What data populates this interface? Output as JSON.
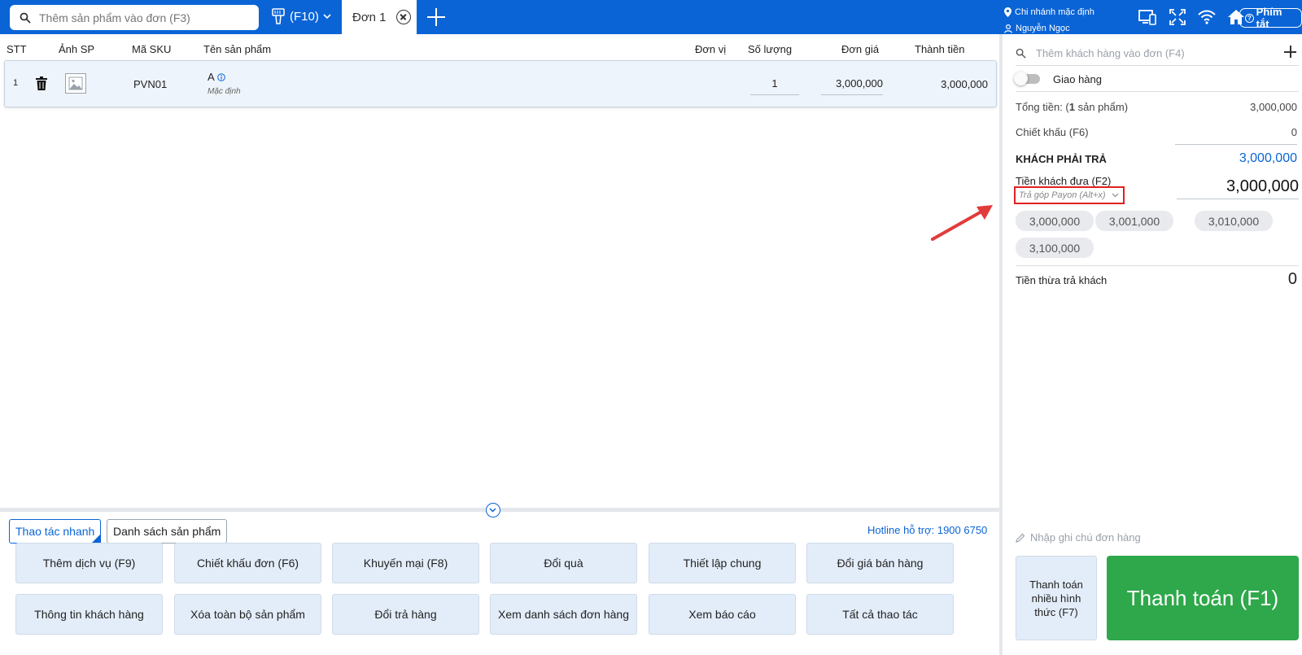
{
  "topbar": {
    "search_placeholder": "Thêm sản phẩm vào đơn (F3)",
    "scan_label": "(F10)",
    "tab_label": "Đơn 1",
    "branch": "Chi nhánh mặc định",
    "user": "Nguyễn Ngọc",
    "shortcut_label": "Phím tắt",
    "accent_color": "#0a64d6"
  },
  "table": {
    "headers": {
      "stt": "STT",
      "image": "Ảnh SP",
      "sku": "Mã SKU",
      "name": "Tên sản phẩm",
      "unit": "Đơn vị",
      "qty": "Số lượng",
      "price": "Đơn giá",
      "total": "Thành tiền"
    },
    "rows": [
      {
        "stt": "1",
        "sku": "PVN01",
        "name": "A",
        "variant": "Mặc định",
        "unit": "",
        "qty": "1",
        "price": "3,000,000",
        "total": "3,000,000"
      }
    ]
  },
  "quick": {
    "tab_quick": "Thao tác nhanh",
    "tab_products": "Danh sách sản phẩm",
    "hotline": "Hotline hỗ trợ: 1900 6750",
    "actions": [
      "Thêm dịch vụ (F9)",
      "Chiết khấu đơn (F6)",
      "Khuyến mại (F8)",
      "Đổi quà",
      "Thiết lập chung",
      "Đổi giá bán hàng",
      "Thông tin khách hàng",
      "Xóa toàn bộ sản phẩm",
      "Đổi trả hàng",
      "Xem danh sách đơn hàng",
      "Xem báo cáo",
      "Tất cả thao tác"
    ]
  },
  "checkout": {
    "customer_placeholder": "Thêm khách hàng vào đơn (F4)",
    "delivery_label": "Giao hàng",
    "total_label_prefix": "Tổng tiền: (",
    "total_count": "1",
    "total_label_suffix": " sản phẩm)",
    "total_value": "3,000,000",
    "discount_label": "Chiết khấu (F6)",
    "discount_value": "0",
    "must_pay_label": "KHÁCH PHẢI TRẢ",
    "must_pay_value": "3,000,000",
    "paid_label": "Tiền khách đưa (F2)",
    "payment_method": "Trả góp Payon (Alt+x)",
    "paid_value": "3,000,000",
    "suggestions": [
      "3,000,000",
      "3,001,000",
      "3,010,000",
      "3,100,000"
    ],
    "change_label": "Tiền thừa trả khách",
    "change_value": "0",
    "note_placeholder": "Nhập ghi chú đơn hàng",
    "multi_pay_label": "Thanh toán nhiều hình thức (F7)",
    "pay_label": "Thanh toán (F1)",
    "pay_color": "#2ea84a"
  }
}
